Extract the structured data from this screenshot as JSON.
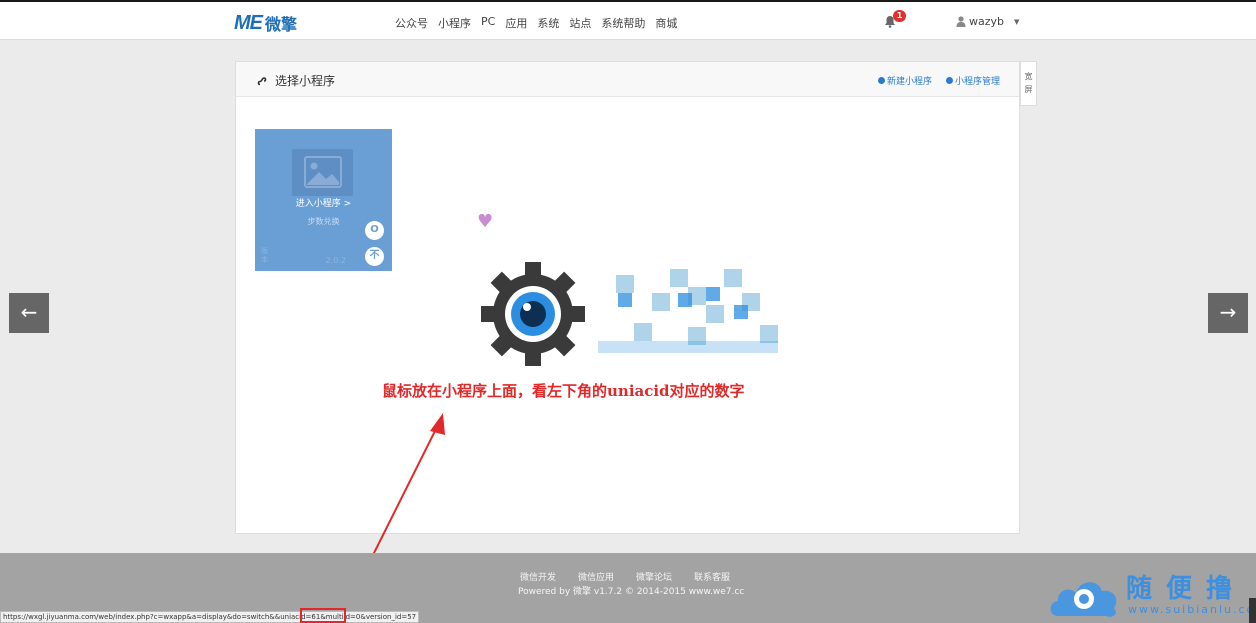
{
  "topbar": {
    "logo_mark": "ME",
    "logo_text": "微擎",
    "nav": [
      "公众号",
      "小程序",
      "PC",
      "应用",
      "系统",
      "站点",
      "系统帮助",
      "商城"
    ],
    "notify_count": "1",
    "username": "wazyb"
  },
  "panel": {
    "title": "选择小程序",
    "new_link": "新建小程序",
    "manage_link": "小程序管理"
  },
  "side_tab": "宽屏",
  "card": {
    "enter_label": "进入小程序",
    "subtitle": "步数兑换",
    "version": "2.0.2",
    "corner_label": "版本"
  },
  "annotation": "鼠标放在小程序上面，看左下角的uniacid对应的数字",
  "footer": {
    "links": [
      "微信开发",
      "微信应用",
      "微擎论坛",
      "联系客服"
    ],
    "copyright": "Powered by 微擎 v1.7.2 © 2014-2015 www.we7.cc"
  },
  "statusbar": {
    "url": "https://wxgl.jiyuanma.com/web/index.php?c=wxapp&a=display&do=switch&&uniacid=61&multiid=0&version_id=57"
  },
  "watermark": {
    "text": "随便撸",
    "url": "www.suibianlu.com"
  },
  "colors": {
    "brand": "#1f6fb5",
    "card": "#6a9fd6",
    "annotation": "#e22828",
    "link": "#2a7ad2"
  }
}
